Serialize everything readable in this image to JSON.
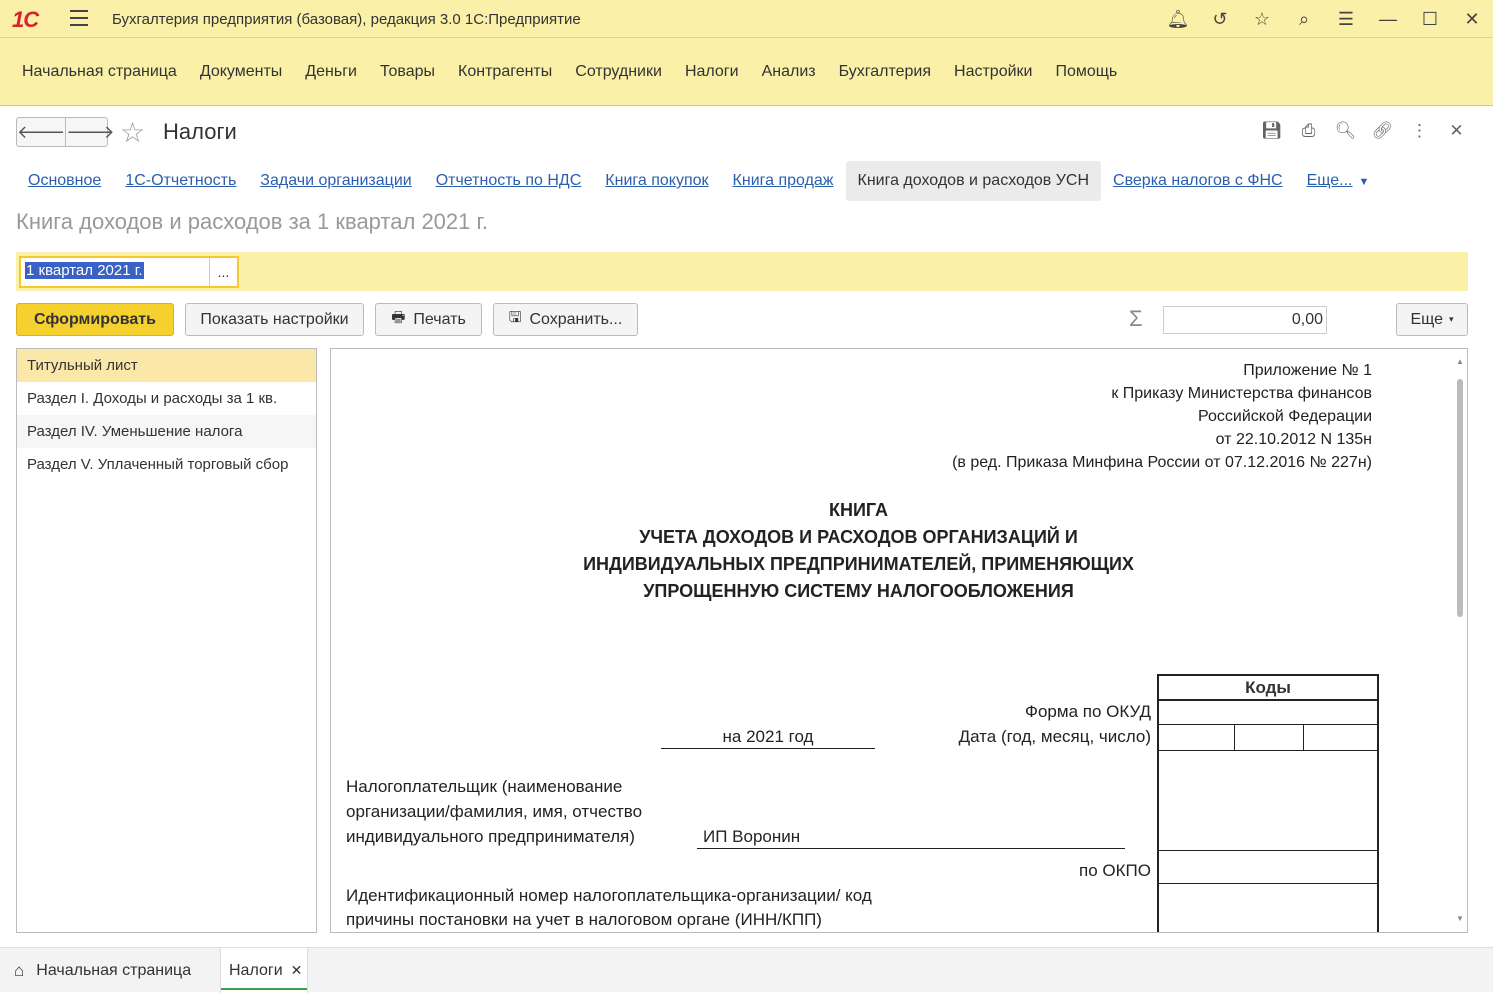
{
  "app": {
    "logo": "1С",
    "title": "Бухгалтерия предприятия (базовая), редакция 3.0 1С:Предприятие"
  },
  "menu": [
    "Начальная страница",
    "Документы",
    "Деньги",
    "Товары",
    "Контрагенты",
    "Сотрудники",
    "Налоги",
    "Анализ",
    "Бухгалтерия",
    "Настройки",
    "Помощь"
  ],
  "page": {
    "title": "Налоги",
    "subtitle": "Книга доходов и расходов за 1 квартал 2021 г."
  },
  "tabs": {
    "t0": "Основное",
    "t1": "1С-Отчетность",
    "t2": "Задачи организации",
    "t3": "Отчетность по НДС",
    "t4": "Книга покупок",
    "t5": "Книга продаж",
    "t6": "Книга доходов и расходов УСН",
    "t7": "Сверка налогов с ФНС",
    "more": "Еще..."
  },
  "period": {
    "value": "1 квартал 2021 г.",
    "dots": "..."
  },
  "toolbar": {
    "generate": "Сформировать",
    "settings": "Показать настройки",
    "print": "Печать",
    "save": "Сохранить...",
    "sum": "0,00",
    "more": "Еще"
  },
  "sections": [
    "Титульный лист",
    "Раздел I. Доходы и расходы за 1 кв.",
    "Раздел IV. Уменьшение налога",
    "Раздел V. Уплаченный торговый сбор"
  ],
  "report": {
    "appendix": [
      "Приложение № 1",
      "к Приказу Министерства финансов",
      "Российской Федерации",
      "от 22.10.2012 N 135н",
      "(в ред. Приказа Минфина России от 07.12.2016 № 227н)"
    ],
    "title": [
      "КНИГА",
      "УЧЕТА ДОХОДОВ И РАСХОДОВ ОРГАНИЗАЦИЙ И",
      "ИНДИВИДУАЛЬНЫХ ПРЕДПРИНИМАТЕЛЕЙ, ПРИМЕНЯЮЩИХ",
      "УПРОЩЕННУЮ СИСТЕМУ НАЛОГООБЛОЖЕНИЯ"
    ],
    "codes_header": "Коды",
    "okud_label": "Форма по ОКУД",
    "year": "на 2021 год",
    "date_label": "Дата (год, месяц, число)",
    "taxpayer_label": [
      "Налогоплательщик (наименование",
      "организации/фамилия, имя, отчество",
      "индивидуального предпринимателя)"
    ],
    "taxpayer_value": "ИП Воронин",
    "okpo_label": "по ОКПО",
    "inn_label": [
      "Идентификационный номер налогоплательщика-организации/ код",
      "причины постановки на учет в налоговом органе (ИНН/КПП)"
    ]
  },
  "bottom_tabs": {
    "home": "Начальная страница",
    "current": "Налоги"
  },
  "colors": {
    "accent": "#fbf0a8",
    "primary_button": "#f5d130",
    "link": "#2a5fb0"
  }
}
